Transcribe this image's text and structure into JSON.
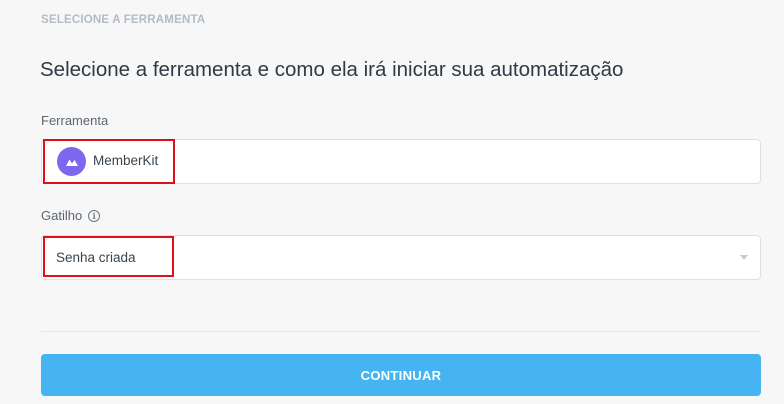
{
  "section": {
    "step_label": "SELECIONE A FERRAMENTA",
    "heading": "Selecione a ferramenta e como ela irá iniciar sua automatização"
  },
  "tool_field": {
    "label": "Ferramenta",
    "value": "MemberKit",
    "icon": "memberkit-logo-icon",
    "icon_color": "#7b68ee"
  },
  "trigger_field": {
    "label": "Gatilho",
    "info_icon": "info-icon",
    "value": "Senha criada"
  },
  "actions": {
    "continue_label": "CONTINUAR",
    "continue_color": "#45b4f0"
  },
  "annotation_color": "#e0101a"
}
